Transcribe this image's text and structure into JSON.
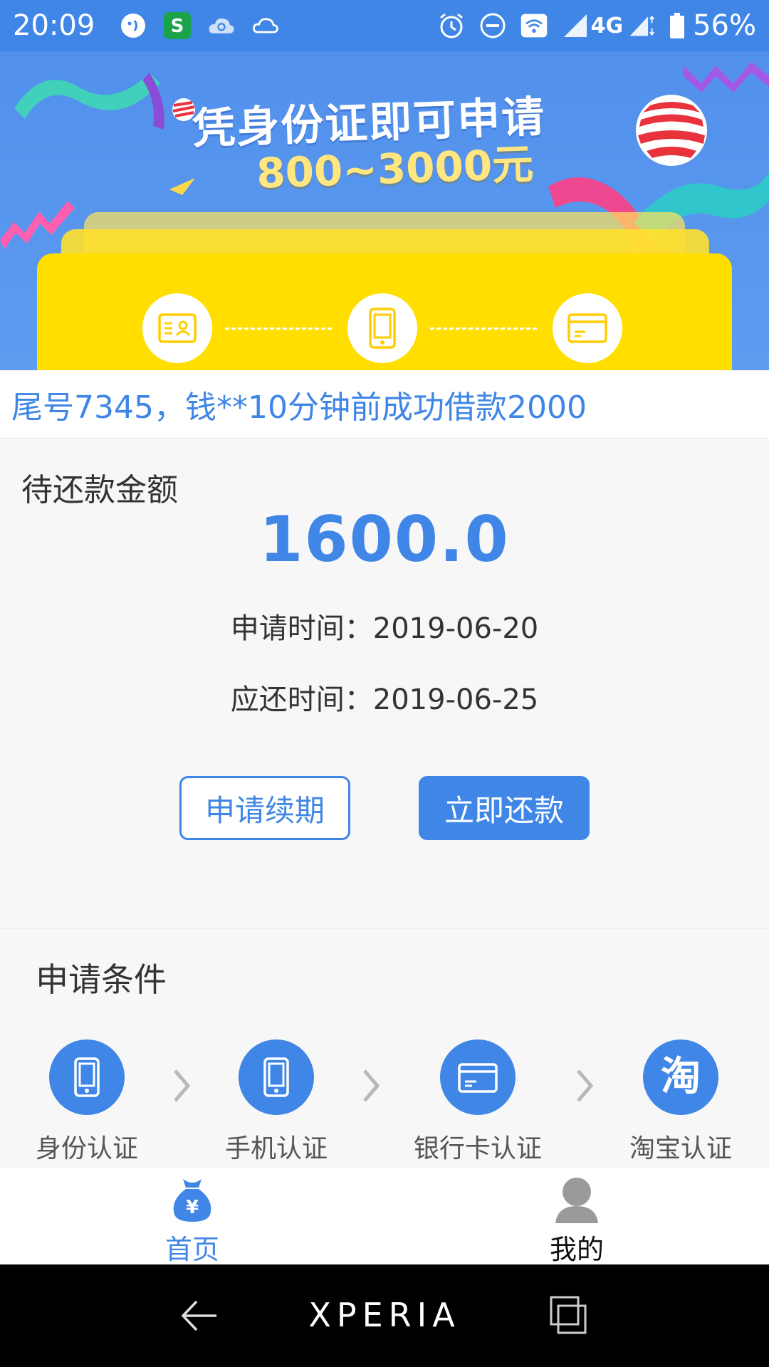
{
  "status_bar": {
    "time": "20:09",
    "network": "4G",
    "battery": "56%",
    "icons": [
      "chat-icon",
      "s-app-icon",
      "cloud-search-icon",
      "cloud-icon",
      "alarm-icon",
      "do-not-disturb-icon",
      "wifi-icon",
      "signal-icon",
      "signal-icon",
      "battery-icon"
    ]
  },
  "banner": {
    "headline": "凭身份证即可申请",
    "amount": "800~3000元",
    "steps": [
      "id-card-icon",
      "phone-icon",
      "bank-card-icon"
    ]
  },
  "notice": {
    "text": "尾号7345，钱**10分钟前成功借款2000"
  },
  "repayment": {
    "label": "待还款金额",
    "amount": "1600.0",
    "apply_label": "申请时间：",
    "apply_date": "2019-06-20",
    "due_label": "应还时间：",
    "due_date": "2019-06-25",
    "extend_button": "申请续期",
    "repay_button": "立即还款"
  },
  "conditions": {
    "title": "申请条件",
    "items": [
      {
        "label": "身份认证",
        "icon": "phone-icon"
      },
      {
        "label": "手机认证",
        "icon": "phone-icon"
      },
      {
        "label": "银行卡认证",
        "icon": "bank-card-icon"
      },
      {
        "label": "淘宝认证",
        "icon": "taobao-icon",
        "glyph": "淘"
      }
    ]
  },
  "tabbar": {
    "items": [
      {
        "label": "首页",
        "icon": "money-bag-icon",
        "active": true
      },
      {
        "label": "我的",
        "icon": "user-icon",
        "active": false
      }
    ],
    "bag_glyph": "¥"
  },
  "navbar": {
    "brand": "XPERIA"
  },
  "colors": {
    "primary": "#3f86e6",
    "banner_yellow": "#ffde00",
    "amount_gold": "#ffe680"
  }
}
